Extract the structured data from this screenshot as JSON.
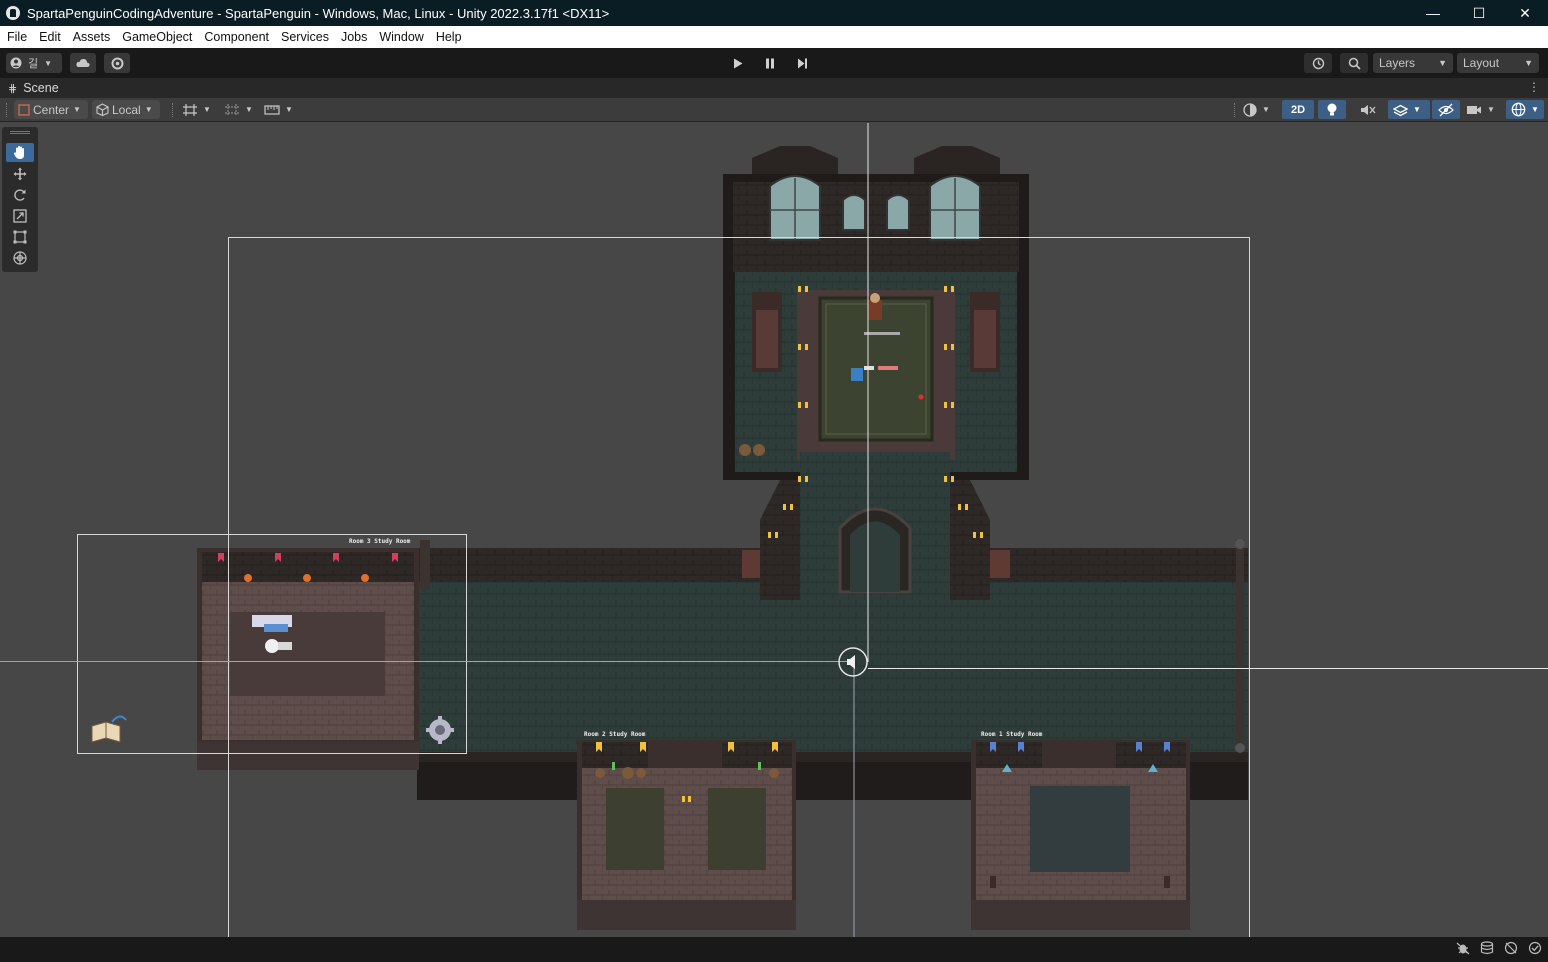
{
  "window": {
    "title": "SpartaPenguinCodingAdventure - SpartaPenguin - Windows, Mac, Linux - Unity 2022.3.17f1 <DX11>",
    "minimize_glyph": "—",
    "maximize_glyph": "☐",
    "close_glyph": "✕"
  },
  "menu": [
    "File",
    "Edit",
    "Assets",
    "GameObject",
    "Component",
    "Services",
    "Jobs",
    "Window",
    "Help"
  ],
  "toolbar": {
    "account_label": "길",
    "layers_label": "Layers",
    "layout_label": "Layout"
  },
  "scene_tab": {
    "label": "Scene"
  },
  "scene_toolbar": {
    "pivot_label": "Center",
    "space_label": "Local",
    "mode_2d_label": "2D"
  },
  "game_labels": {
    "room_left": "Room 3 Study Room",
    "room_bottom_mid": "Room 2 Study Room",
    "room_bottom_right": "Room 1 Study Room"
  },
  "colors": {
    "titlebar_bg": "#0b1d24",
    "menubar_bg": "#ffffff",
    "toolbar_bg": "#191919",
    "scene_bg": "#474747",
    "active_tool": "#3d6a9c",
    "floor_green": "#2e3c38",
    "wall_dark": "#2b2624",
    "floor_brown": "#5a4a48"
  }
}
